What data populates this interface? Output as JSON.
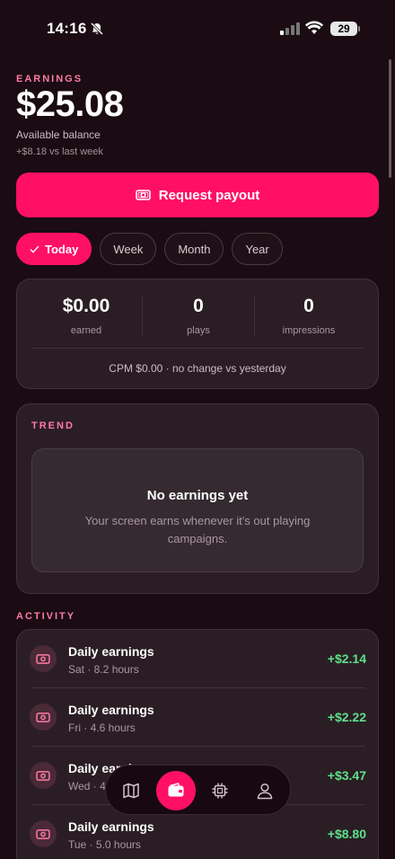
{
  "status": {
    "time": "14:16",
    "battery": "29"
  },
  "earnings": {
    "section_label": "EARNINGS",
    "balance": "$25.08",
    "available_label": "Available balance",
    "delta": "+$8.18 vs last week",
    "payout_label": "Request payout"
  },
  "periods": {
    "today": "Today",
    "week": "Week",
    "month": "Month",
    "year": "Year",
    "selected": "Today"
  },
  "stats": {
    "earned_value": "$0.00",
    "earned_label": "earned",
    "plays_value": "0",
    "plays_label": "plays",
    "impressions_value": "0",
    "impressions_label": "impressions",
    "cpm": "CPM $0.00 · no change vs yesterday"
  },
  "trend": {
    "section_label": "TREND",
    "empty_title": "No earnings yet",
    "empty_sub": "Your screen earns whenever it's out playing campaigns."
  },
  "activity": {
    "section_label": "ACTIVITY",
    "items": [
      {
        "title": "Daily earnings",
        "sub": "Sat · 8.2 hours",
        "amount": "+$2.14"
      },
      {
        "title": "Daily earnings",
        "sub": "Fri · 4.6 hours",
        "amount": "+$2.22"
      },
      {
        "title": "Daily earnings",
        "sub": "Wed · 4.",
        "amount": "+$3.47"
      },
      {
        "title": "Daily earnings",
        "sub": "Tue · 5.0 hours",
        "amount": "+$8.80"
      }
    ]
  },
  "colors": {
    "accent": "#ff1064",
    "positive": "#5ee08a",
    "label": "#ff7aa8",
    "background": "#1a0c12"
  },
  "tabbar": {
    "icons": [
      "map-icon",
      "wallet-icon",
      "chip-icon",
      "person-icon"
    ],
    "active": "wallet-icon"
  }
}
